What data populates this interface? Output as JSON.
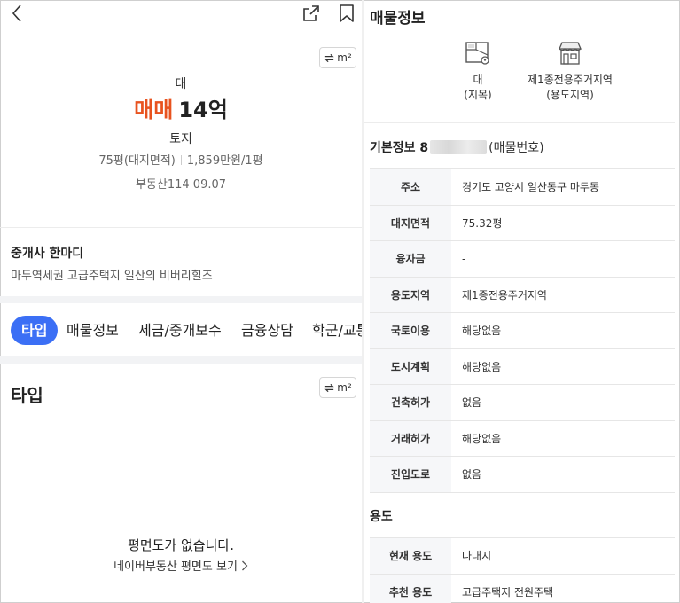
{
  "left": {
    "unit_label": "m²",
    "summary": {
      "category": "대",
      "price_type": "매매",
      "price_value": "14억",
      "kind": "토지",
      "area": "75평(대지면적)",
      "unit_price": "1,859만원/1평",
      "source": "부동산114 09.07"
    },
    "comment": {
      "title": "중개사 한마디",
      "body": "마두역세권  고급주택지  일산의 비버리힐즈"
    },
    "tabs": [
      "타입",
      "매물정보",
      "세금/중개보수",
      "금융상담",
      "학군/교통"
    ],
    "type_section": {
      "title": "타입",
      "no_floorplan": "평면도가 없습니다.",
      "naver_link": "네이버부동산 평면도 보기"
    }
  },
  "right": {
    "title": "매물정보",
    "features": [
      {
        "value": "대",
        "sub": "(지목)"
      },
      {
        "value": "제1종전용주거지역",
        "sub": "(용도지역)"
      }
    ],
    "basic": {
      "title_prefix": "기본정보 8",
      "title_suffix": "(매물번호)",
      "rows": [
        {
          "k": "주소",
          "v": "경기도 고양시 일산동구 마두동"
        },
        {
          "k": "대지면적",
          "v": "75.32평"
        },
        {
          "k": "융자금",
          "v": "-"
        },
        {
          "k": "용도지역",
          "v": "제1종전용주거지역"
        },
        {
          "k": "국토이용",
          "v": "해당없음"
        },
        {
          "k": "도시계획",
          "v": "해당없음"
        },
        {
          "k": "건축허가",
          "v": "없음"
        },
        {
          "k": "거래허가",
          "v": "해당없음"
        },
        {
          "k": "진입도로",
          "v": "없음"
        }
      ]
    },
    "use": {
      "title": "용도",
      "rows": [
        {
          "k": "현재 용도",
          "v": "나대지"
        },
        {
          "k": "추천 용도",
          "v": "고급주택지 전원주택"
        }
      ]
    }
  }
}
